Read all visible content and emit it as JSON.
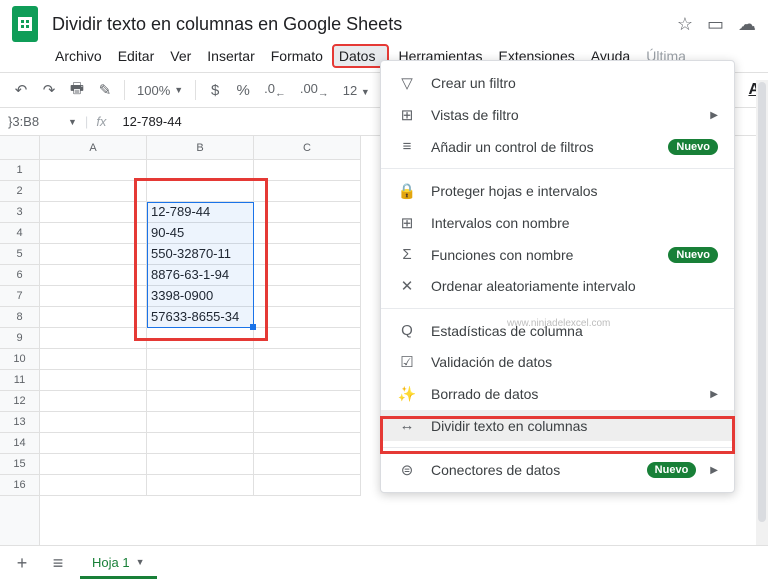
{
  "doc_title": "Dividir texto en columnas en Google Sheets",
  "menubar": [
    "Archivo",
    "Editar",
    "Ver",
    "Insertar",
    "Formato",
    "Datos",
    "Herramientas",
    "Extensiones",
    "Ayuda",
    "Última"
  ],
  "menubar_highlighted_index": 5,
  "toolbar": {
    "zoom": "100%",
    "currency": "$",
    "percent": "%",
    "decimal_dec": ".0",
    "decimal_inc": ".00",
    "format": "12"
  },
  "formula_bar": {
    "cell_ref": "}3:B8",
    "fx": "fx",
    "content": "12-789-44"
  },
  "columns": [
    "A",
    "B",
    "C"
  ],
  "rows": [
    1,
    2,
    3,
    4,
    5,
    6,
    7,
    8,
    9,
    10,
    11,
    12,
    13,
    14,
    15,
    16
  ],
  "data_cells": [
    "12-789-44",
    "90-45",
    "550-32870-11",
    "8876-63-1-94",
    "3398-0900",
    "57633-8655-34"
  ],
  "watermark": "www.ninjadelexcel.com",
  "dropdown": {
    "groups": [
      [
        {
          "icon": "▽",
          "label": "Crear un filtro",
          "arrow": false,
          "badge": ""
        },
        {
          "icon": "⊞",
          "label": "Vistas de filtro",
          "arrow": true,
          "badge": ""
        },
        {
          "icon": "≡",
          "label": "Añadir un control de filtros",
          "arrow": false,
          "badge": "Nuevo"
        }
      ],
      [
        {
          "icon": "🔒",
          "label": "Proteger hojas e intervalos",
          "arrow": false,
          "badge": ""
        },
        {
          "icon": "⊞",
          "label": "Intervalos con nombre",
          "arrow": false,
          "badge": ""
        },
        {
          "icon": "Σ",
          "label": "Funciones con nombre",
          "arrow": false,
          "badge": "Nuevo"
        },
        {
          "icon": "✕",
          "label": "Ordenar aleatoriamente intervalo",
          "arrow": false,
          "badge": ""
        }
      ],
      [
        {
          "icon": "Q",
          "label": "Estadísticas de columna",
          "arrow": false,
          "badge": ""
        },
        {
          "icon": "☑",
          "label": "Validación de datos",
          "arrow": false,
          "badge": ""
        },
        {
          "icon": "✨",
          "label": "Borrado de datos",
          "arrow": true,
          "badge": ""
        },
        {
          "icon": "↔",
          "label": "Dividir texto en columnas",
          "arrow": false,
          "badge": "",
          "highlighted": true
        }
      ],
      [
        {
          "icon": "⊜",
          "label": "Conectores de datos",
          "arrow": true,
          "badge": "Nuevo"
        }
      ]
    ]
  },
  "footer": {
    "sheet_name": "Hoja 1"
  }
}
